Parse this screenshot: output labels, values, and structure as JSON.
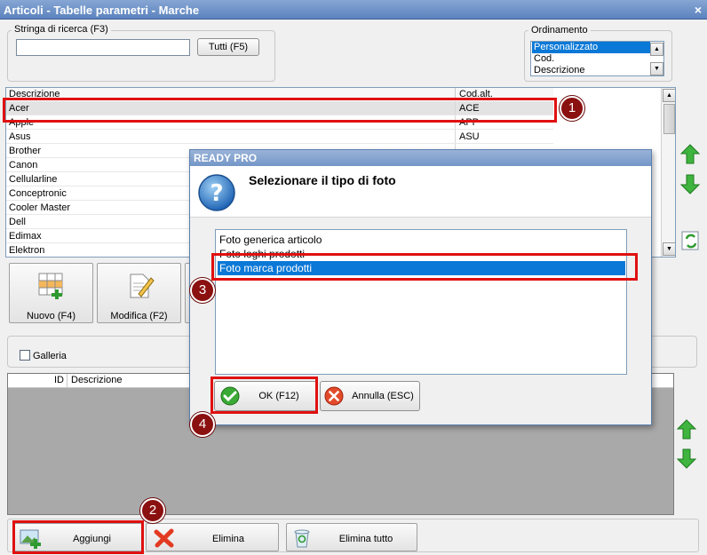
{
  "window": {
    "title": "Articoli - Tabelle parametri - Marche",
    "close_glyph": "×"
  },
  "search": {
    "group_label": "Stringa di ricerca (F3)",
    "value": "",
    "all_button": "Tutti (F5)"
  },
  "ordering": {
    "group_label": "Ordinamento",
    "options": [
      "Personalizzato",
      "Cod.",
      "Descrizione"
    ],
    "selected_index": 0
  },
  "brands_table": {
    "columns": [
      "Descrizione",
      "Cod.alt."
    ],
    "rows": [
      {
        "desc": "Acer",
        "code": "ACE"
      },
      {
        "desc": "Apple",
        "code": "APP"
      },
      {
        "desc": "Asus",
        "code": "ASU"
      },
      {
        "desc": "Brother",
        "code": ""
      },
      {
        "desc": "Canon",
        "code": ""
      },
      {
        "desc": "Cellularline",
        "code": ""
      },
      {
        "desc": "Conceptronic",
        "code": ""
      },
      {
        "desc": "Cooler Master",
        "code": ""
      },
      {
        "desc": "Dell",
        "code": ""
      },
      {
        "desc": "Edimax",
        "code": ""
      },
      {
        "desc": "Elektron",
        "code": ""
      }
    ],
    "selected_index": 0
  },
  "toolbar": {
    "new_button": "Nuovo (F4)",
    "edit_button": "Modifica (F2)"
  },
  "gallery": {
    "checkbox_label": "Galleria",
    "checked": false,
    "columns": [
      "ID",
      "Descrizione"
    ]
  },
  "bottom_bar": {
    "add_button": "Aggiungi",
    "delete_button": "Elimina",
    "delete_all_button": "Elimina tutto"
  },
  "dialog": {
    "title": "READY PRO",
    "heading": "Selezionare il tipo di foto",
    "options": [
      "Foto generica articolo",
      "Foto loghi prodotti",
      "Foto marca prodotti"
    ],
    "selected_index": 2,
    "ok_button": "OK (F12)",
    "cancel_button": "Annulla (ESC)"
  },
  "annotations": [
    "1",
    "2",
    "3",
    "4"
  ],
  "colors": {
    "selection": "#0a78d7",
    "highlight_red": "#e01010",
    "badge": "#8b1010",
    "title_blue": "#5c83bf"
  }
}
